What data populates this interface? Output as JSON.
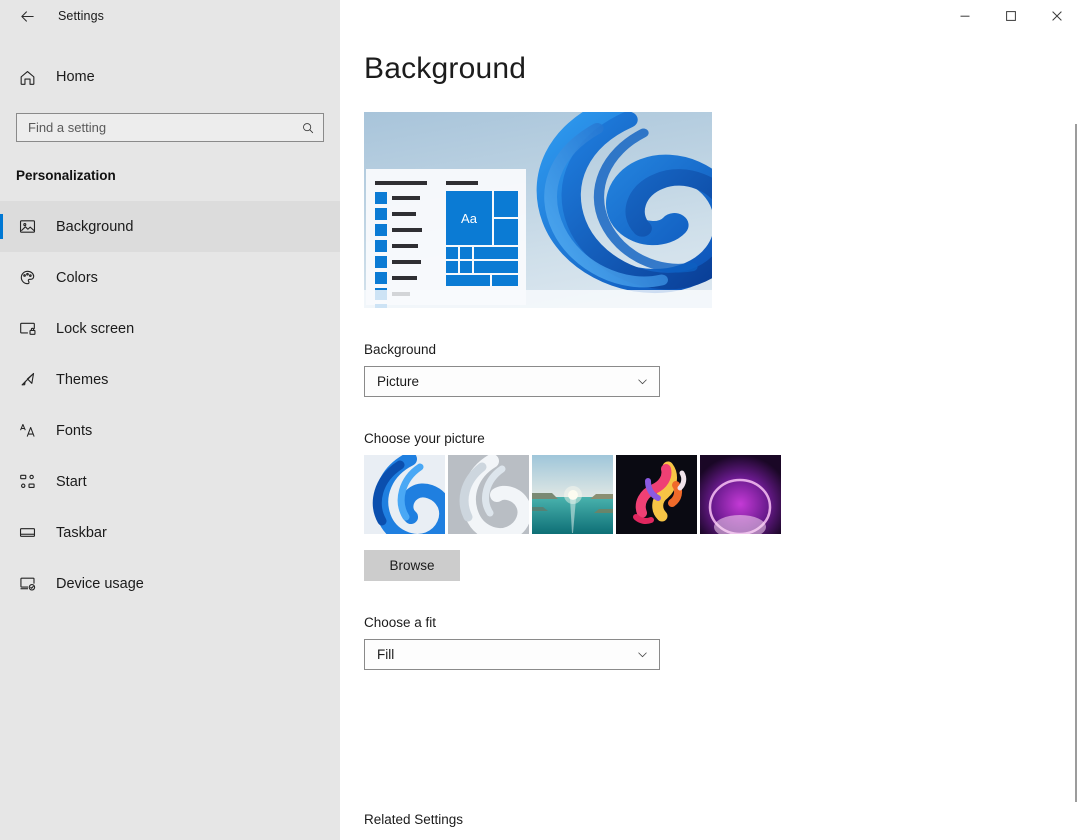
{
  "window": {
    "app_title": "Settings",
    "back_icon": "back-arrow-icon",
    "controls": {
      "minimize": "minimize-icon",
      "maximize": "maximize-icon",
      "close": "close-icon"
    }
  },
  "sidebar": {
    "home": {
      "label": "Home",
      "icon": "home-icon"
    },
    "search": {
      "placeholder": "Find a setting",
      "value": "",
      "icon": "search-icon"
    },
    "section_title": "Personalization",
    "items": [
      {
        "label": "Background",
        "icon": "image-icon",
        "selected": true
      },
      {
        "label": "Colors",
        "icon": "palette-icon",
        "selected": false
      },
      {
        "label": "Lock screen",
        "icon": "lock-screen-icon",
        "selected": false
      },
      {
        "label": "Themes",
        "icon": "brush-icon",
        "selected": false
      },
      {
        "label": "Fonts",
        "icon": "fonts-icon",
        "selected": false
      },
      {
        "label": "Start",
        "icon": "start-tiles-icon",
        "selected": false
      },
      {
        "label": "Taskbar",
        "icon": "taskbar-icon",
        "selected": false
      },
      {
        "label": "Device usage",
        "icon": "device-usage-icon",
        "selected": false
      }
    ]
  },
  "main": {
    "page_title": "Background",
    "preview": {
      "name": "desktop-preview",
      "mock_text": "Aa",
      "sidebar_squares": 8
    },
    "background": {
      "label": "Background",
      "selected": "Picture"
    },
    "choose_picture": {
      "label": "Choose your picture",
      "thumbnails": [
        {
          "name": "wallpaper-blue-bloom"
        },
        {
          "name": "wallpaper-white-bloom"
        },
        {
          "name": "wallpaper-sunset-lake"
        },
        {
          "name": "wallpaper-flower"
        },
        {
          "name": "wallpaper-purple-glow"
        }
      ],
      "browse_label": "Browse"
    },
    "choose_fit": {
      "label": "Choose a fit",
      "selected": "Fill"
    },
    "related_settings": "Related Settings"
  },
  "colors": {
    "accent": "#0078d4",
    "sidebar_bg": "#e6e6e6",
    "selected_row_bg": "#dcdcdc",
    "content_bg": "#ffffff",
    "border": "#8a8a8a",
    "button_bg": "#cccccc",
    "text": "#1b1b1b"
  }
}
